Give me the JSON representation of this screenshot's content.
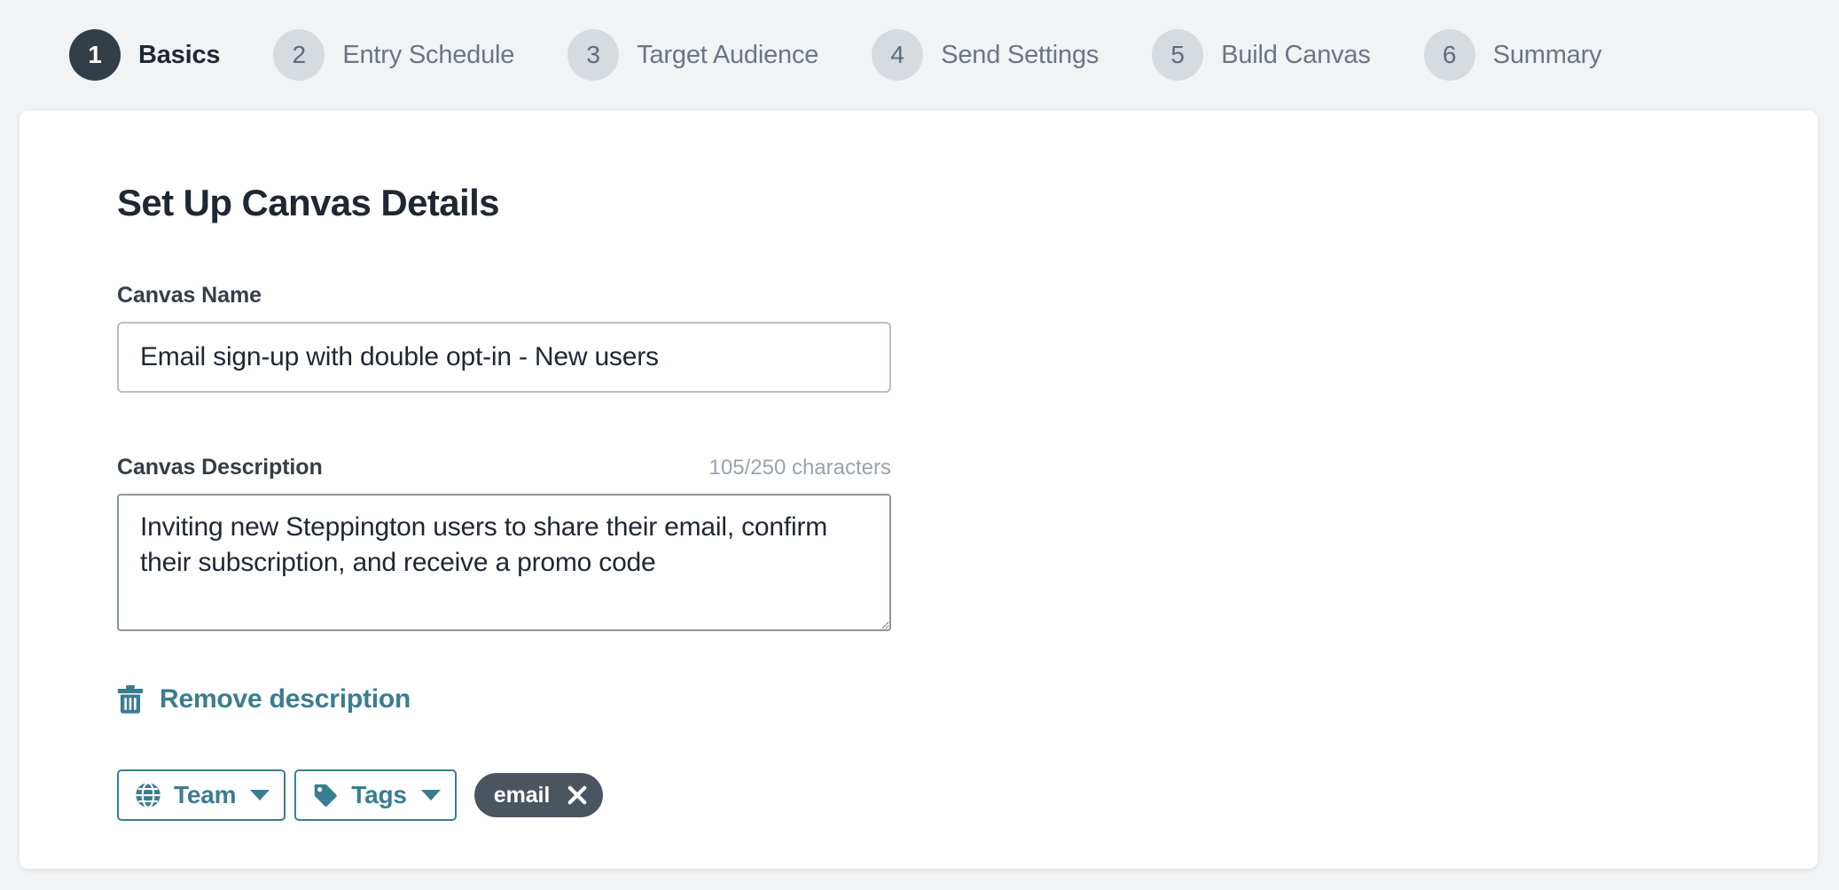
{
  "theme": {
    "page_background": "#f2f3f5",
    "card_background": "#ffffff",
    "accent_teal": "#3a7d91",
    "active_step_dark": "#333e48",
    "inactive_step_grey": "#d6dbdf",
    "chip_dark": "#4a5560",
    "text_dark": "#1f2733",
    "muted_text": "#9aa3ab"
  },
  "stepper": {
    "steps": [
      {
        "number": "1",
        "label": "Basics",
        "active": true
      },
      {
        "number": "2",
        "label": "Entry Schedule",
        "active": false
      },
      {
        "number": "3",
        "label": "Target Audience",
        "active": false
      },
      {
        "number": "4",
        "label": "Send Settings",
        "active": false
      },
      {
        "number": "5",
        "label": "Build Canvas",
        "active": false
      },
      {
        "number": "6",
        "label": "Summary",
        "active": false
      }
    ]
  },
  "card": {
    "title": "Set Up Canvas Details",
    "canvas_name": {
      "label": "Canvas Name",
      "value": "Email sign-up with double opt-in - New users",
      "placeholder": "Canvas Name"
    },
    "canvas_description": {
      "label": "Canvas Description",
      "char_count": "105/250 characters",
      "value": "Inviting new Steppington users to share their email, confirm their subscription, and receive a promo code",
      "placeholder": "Canvas Description"
    },
    "remove_description": {
      "label": "Remove description",
      "icon": "trash-icon"
    },
    "team_button": {
      "label": "Team",
      "icon": "globe-icon",
      "caret": "chevron-down-icon"
    },
    "tags_button": {
      "label": "Tags",
      "icon": "tag-icon",
      "caret": "chevron-down-icon"
    },
    "tags": [
      {
        "label": "email",
        "close_icon": "close-icon"
      }
    ]
  }
}
